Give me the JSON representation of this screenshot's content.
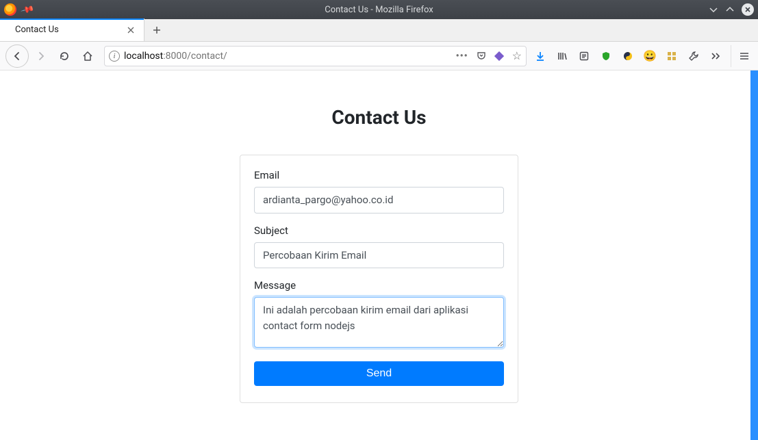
{
  "window": {
    "title": "Contact Us - Mozilla Firefox"
  },
  "tab": {
    "label": "Contact Us"
  },
  "url": {
    "host": "localhost",
    "port_path": ":8000/contact/"
  },
  "page": {
    "heading": "Contact Us",
    "email_label": "Email",
    "email_value": "ardianta_pargo@yahoo.co.id",
    "subject_label": "Subject",
    "subject_value": "Percobaan Kirim Email",
    "message_label": "Message",
    "message_value": "Ini adalah percobaan kirim email dari aplikasi contact form nodejs",
    "send_label": "Send"
  }
}
